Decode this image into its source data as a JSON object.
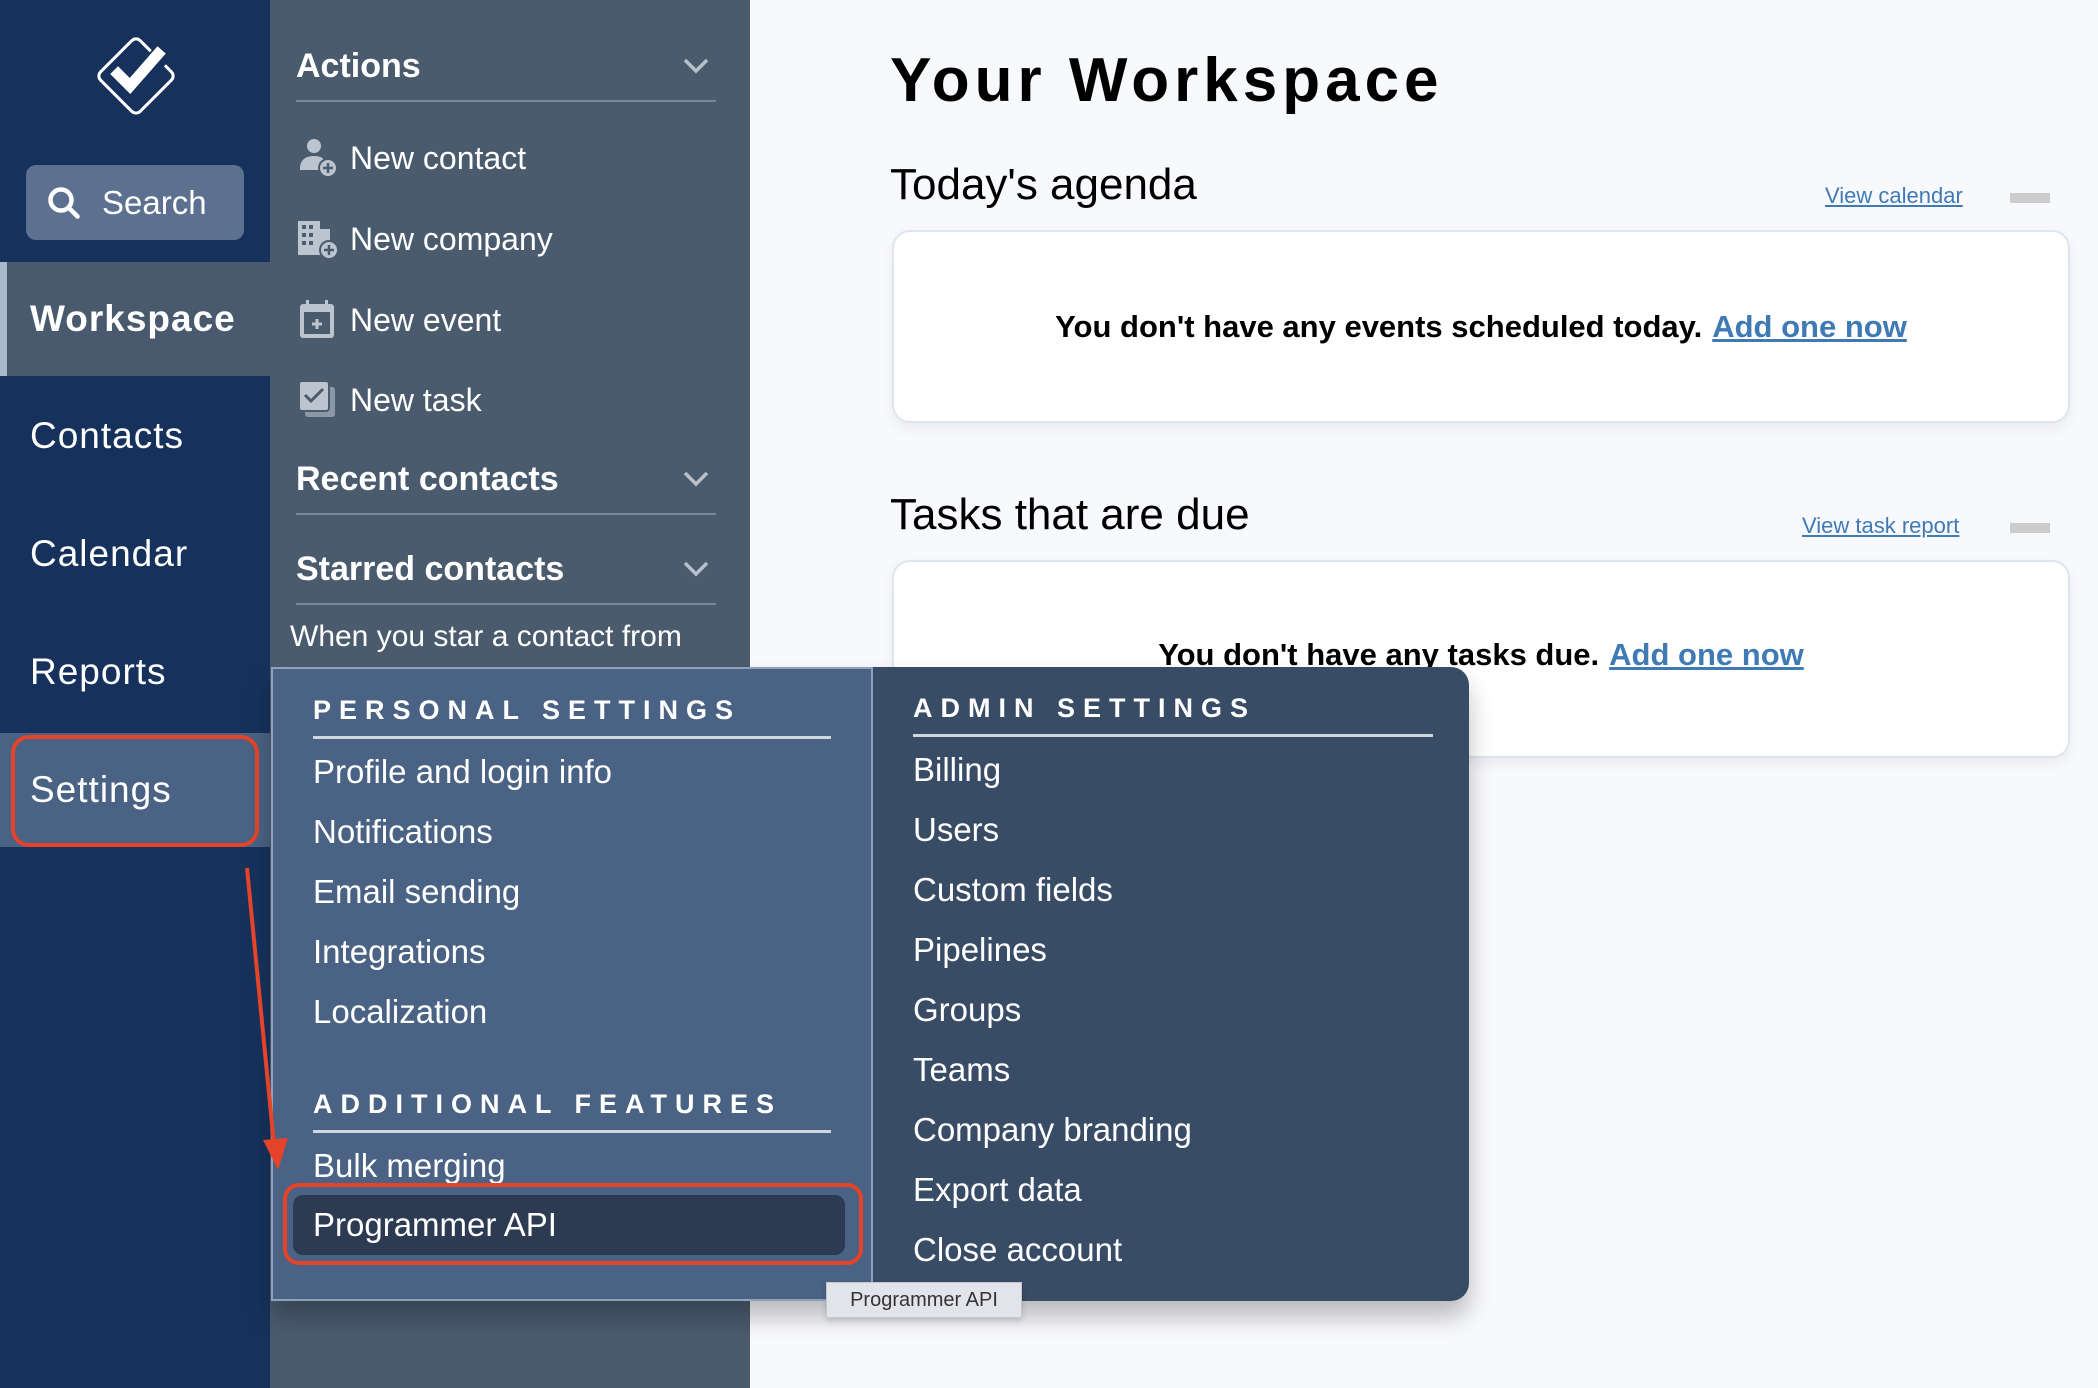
{
  "nav": {
    "logo_icon": "checkbox-diamond-logo",
    "search_label": "Search",
    "items": [
      {
        "label": "Workspace",
        "active": true
      },
      {
        "label": "Contacts"
      },
      {
        "label": "Calendar"
      },
      {
        "label": "Reports"
      },
      {
        "label": "Settings",
        "highlighted": true
      }
    ]
  },
  "panel": {
    "actions_heading": "Actions",
    "actions": [
      {
        "label": "New contact",
        "icon": "add-person-icon"
      },
      {
        "label": "New company",
        "icon": "add-building-icon"
      },
      {
        "label": "New event",
        "icon": "calendar-plus-icon"
      },
      {
        "label": "New task",
        "icon": "checkbox-stack-icon"
      }
    ],
    "recent_heading": "Recent contacts",
    "starred_heading": "Starred contacts",
    "starred_note": "When you star a contact from"
  },
  "main": {
    "title": "Your Workspace",
    "agenda": {
      "title": "Today's agenda",
      "link": "View calendar",
      "empty_text": "You don't have any events scheduled today.",
      "add_link": "Add one now"
    },
    "tasks": {
      "title": "Tasks that are due",
      "link": "View task report",
      "empty_text": "You don't have any tasks due.",
      "add_link": "Add one now"
    }
  },
  "settings_menu": {
    "personal_heading": "PERSONAL SETTINGS",
    "personal_items": [
      "Profile and login info",
      "Notifications",
      "Email sending",
      "Integrations",
      "Localization"
    ],
    "additional_heading": "ADDITIONAL FEATURES",
    "additional_items": [
      "Bulk merging",
      "Programmer API"
    ],
    "admin_heading": "ADMIN SETTINGS",
    "admin_items": [
      "Billing",
      "Users",
      "Custom fields",
      "Pipelines",
      "Groups",
      "Teams",
      "Company branding",
      "Export data",
      "Close account"
    ],
    "hovered_item": "Programmer API",
    "tooltip": "Programmer API"
  },
  "colors": {
    "nav_bg": "#16325c",
    "panel_bg": "#4b5b6e",
    "link": "#3f7ab5",
    "annotation_red": "#e5432a"
  }
}
